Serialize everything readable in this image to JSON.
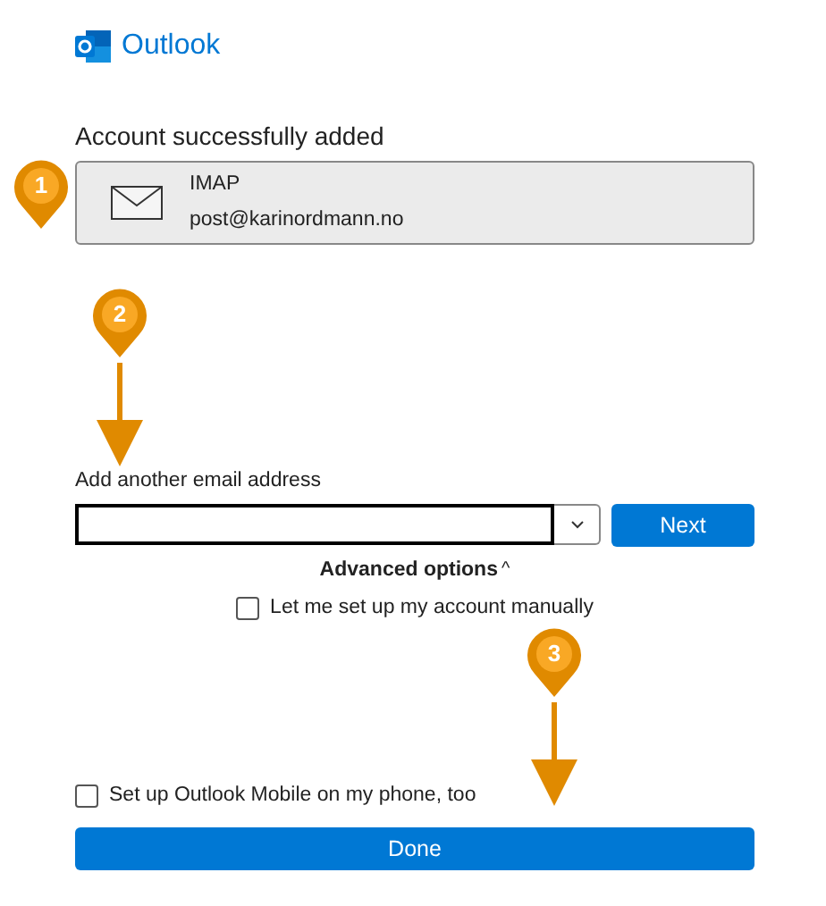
{
  "app": {
    "title": "Outlook"
  },
  "heading": "Account successfully added",
  "account": {
    "type": "IMAP",
    "email": "post@karinordmann.no"
  },
  "email_field": {
    "label": "Add another email address"
  },
  "next_button": "Next",
  "advanced_options": {
    "label": "Advanced options",
    "expanded": true,
    "expander": "^"
  },
  "manual_setup": {
    "label": "Let me set up my account manually",
    "checked": false
  },
  "mobile_setup": {
    "label": "Set up Outlook Mobile on my phone, too",
    "checked": false
  },
  "done_button": "Done",
  "annotations": [
    {
      "number": "1",
      "arrow": false
    },
    {
      "number": "2",
      "arrow": true
    },
    {
      "number": "3",
      "arrow": true
    }
  ]
}
